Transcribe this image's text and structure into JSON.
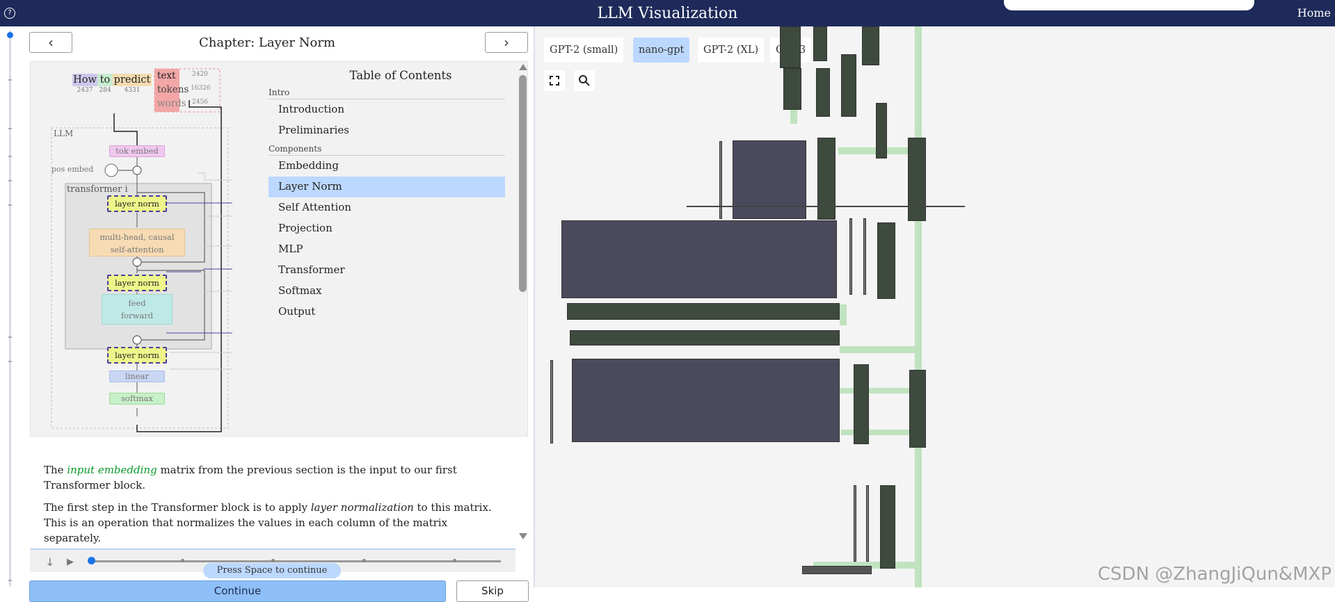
{
  "header": {
    "title": "LLM Visualization",
    "home_label": "Home",
    "help_icon": "?"
  },
  "chapter": {
    "title": "Chapter: Layer Norm",
    "prev_icon": "‹",
    "next_icon": "›"
  },
  "diagram": {
    "tokens": [
      {
        "word": "How",
        "id": "2437"
      },
      {
        "word": "to",
        "id": "284"
      },
      {
        "word": "predict",
        "id": "4331"
      }
    ],
    "output_labels": [
      {
        "label": "text",
        "value": "2420"
      },
      {
        "label": "tokens",
        "value": "16326"
      },
      {
        "label": "words",
        "value": "2456"
      }
    ],
    "llm_label": "LLM",
    "tok_embed": "tok embed",
    "pos_embed": "pos embed",
    "transformer_label": "transformer i",
    "layer_norm": "layer norm",
    "attention_line1": "multi-head, causal",
    "attention_line2": "self-attention",
    "ffn_line1": "feed",
    "ffn_line2": "forward",
    "linear": "linear",
    "softmax": "softmax"
  },
  "toc": {
    "title": "Table of Contents",
    "sections": [
      {
        "name": "Intro",
        "items": [
          "Introduction",
          "Preliminaries"
        ]
      },
      {
        "name": "Components",
        "items": [
          "Embedding",
          "Layer Norm",
          "Self Attention",
          "Projection",
          "MLP",
          "Transformer",
          "Softmax",
          "Output"
        ]
      }
    ],
    "active": "Layer Norm"
  },
  "text": {
    "p1_before": "The ",
    "p1_link": "input embedding",
    "p1_after": " matrix from the previous section is the input to our first Transformer block.",
    "p2_before": "The first step in the Transformer block is to apply ",
    "p2_em": "layer normalization",
    "p2_after": " to this matrix. This is an operation that normalizes the values in each column of the matrix separately."
  },
  "controls": {
    "space_hint": "Press Space to continue",
    "continue_label": "Continue",
    "skip_label": "Skip",
    "down_icon": "↓",
    "play_icon": "▶"
  },
  "models": {
    "items": [
      "GPT-2 (small)",
      "nano-gpt",
      "GPT-2 (XL)",
      "GPT-3"
    ],
    "active": "nano-gpt"
  },
  "watermark": "CSDN @ZhangJiQun&MXP",
  "colors": {
    "header_bg": "#1e2a5a",
    "active_bg": "#bcd8ff",
    "continue_bg": "#8fbff7",
    "layer_norm_fill": "#eef58a",
    "layer_norm_border": "#4a3fa0",
    "link_green": "#0a9a2a"
  }
}
